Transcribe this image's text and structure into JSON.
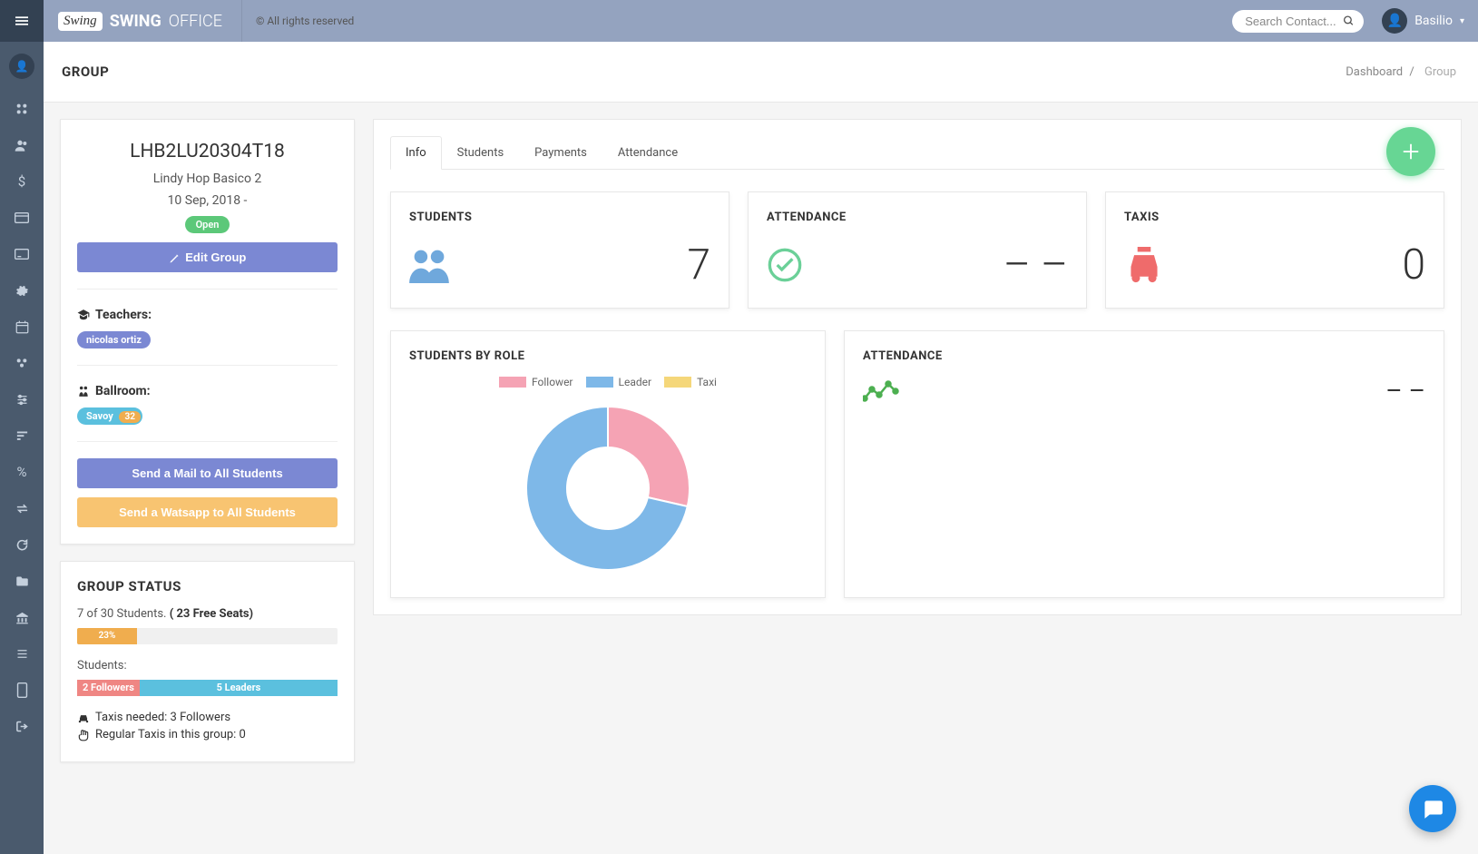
{
  "topbar": {
    "brand_cursive": "Swing",
    "brand_bold": "SWING",
    "brand_thin": "OFFICE",
    "copyright": "© All rights reserved",
    "search_placeholder": "Search Contact...",
    "username": "Basilio"
  },
  "page": {
    "heading": "GROUP",
    "breadcrumb_home": "Dashboard",
    "breadcrumb_current": "Group"
  },
  "group": {
    "code": "LHB2LU20304T18",
    "name": "Lindy Hop Basico 2",
    "date": "10 Sep, 2018 -",
    "status_badge": "Open",
    "edit_btn": "Edit Group",
    "teachers_label": "Teachers:",
    "teacher_name": "nicolas ortiz",
    "ballroom_label": "Ballroom:",
    "ballroom_name": "Savoy",
    "ballroom_count": "32",
    "mail_btn": "Send a Mail to All Students",
    "whatsapp_btn": "Send a Watsapp to All Students"
  },
  "status": {
    "title": "GROUP STATUS",
    "seats_text": "7 of 30 Students. ",
    "seats_free": "( 23 Free Seats)",
    "seats_pct": "23%",
    "seats_pct_num": 23,
    "students_label": "Students:",
    "followers": "2 Followers",
    "followers_pct": 24,
    "leaders": "5 Leaders",
    "leaders_pct": 76,
    "taxis_needed": "Taxis needed: 3 Followers",
    "taxis_regular": "Regular Taxis in this group: 0"
  },
  "tabs": {
    "info": "Info",
    "students": "Students",
    "payments": "Payments",
    "attendance": "Attendance"
  },
  "stats": {
    "students_label": "STUDENTS",
    "students_value": "7",
    "attendance_label": "ATTENDANCE",
    "attendance_value": "– –",
    "taxis_label": "TAXIS",
    "taxis_value": "0"
  },
  "chart_roles": {
    "title": "STUDENTS BY ROLE",
    "legend": {
      "follower": "Follower",
      "leader": "Leader",
      "taxi": "Taxi"
    }
  },
  "chart_att": {
    "title": "ATTENDANCE",
    "value": "– –"
  },
  "chart_data": {
    "type": "pie",
    "title": "Students by Role",
    "series": [
      {
        "name": "Follower",
        "value": 2,
        "color": "#f5a3b4"
      },
      {
        "name": "Leader",
        "value": 5,
        "color": "#7eb8e8"
      },
      {
        "name": "Taxi",
        "value": 0,
        "color": "#f5d77a"
      }
    ]
  }
}
